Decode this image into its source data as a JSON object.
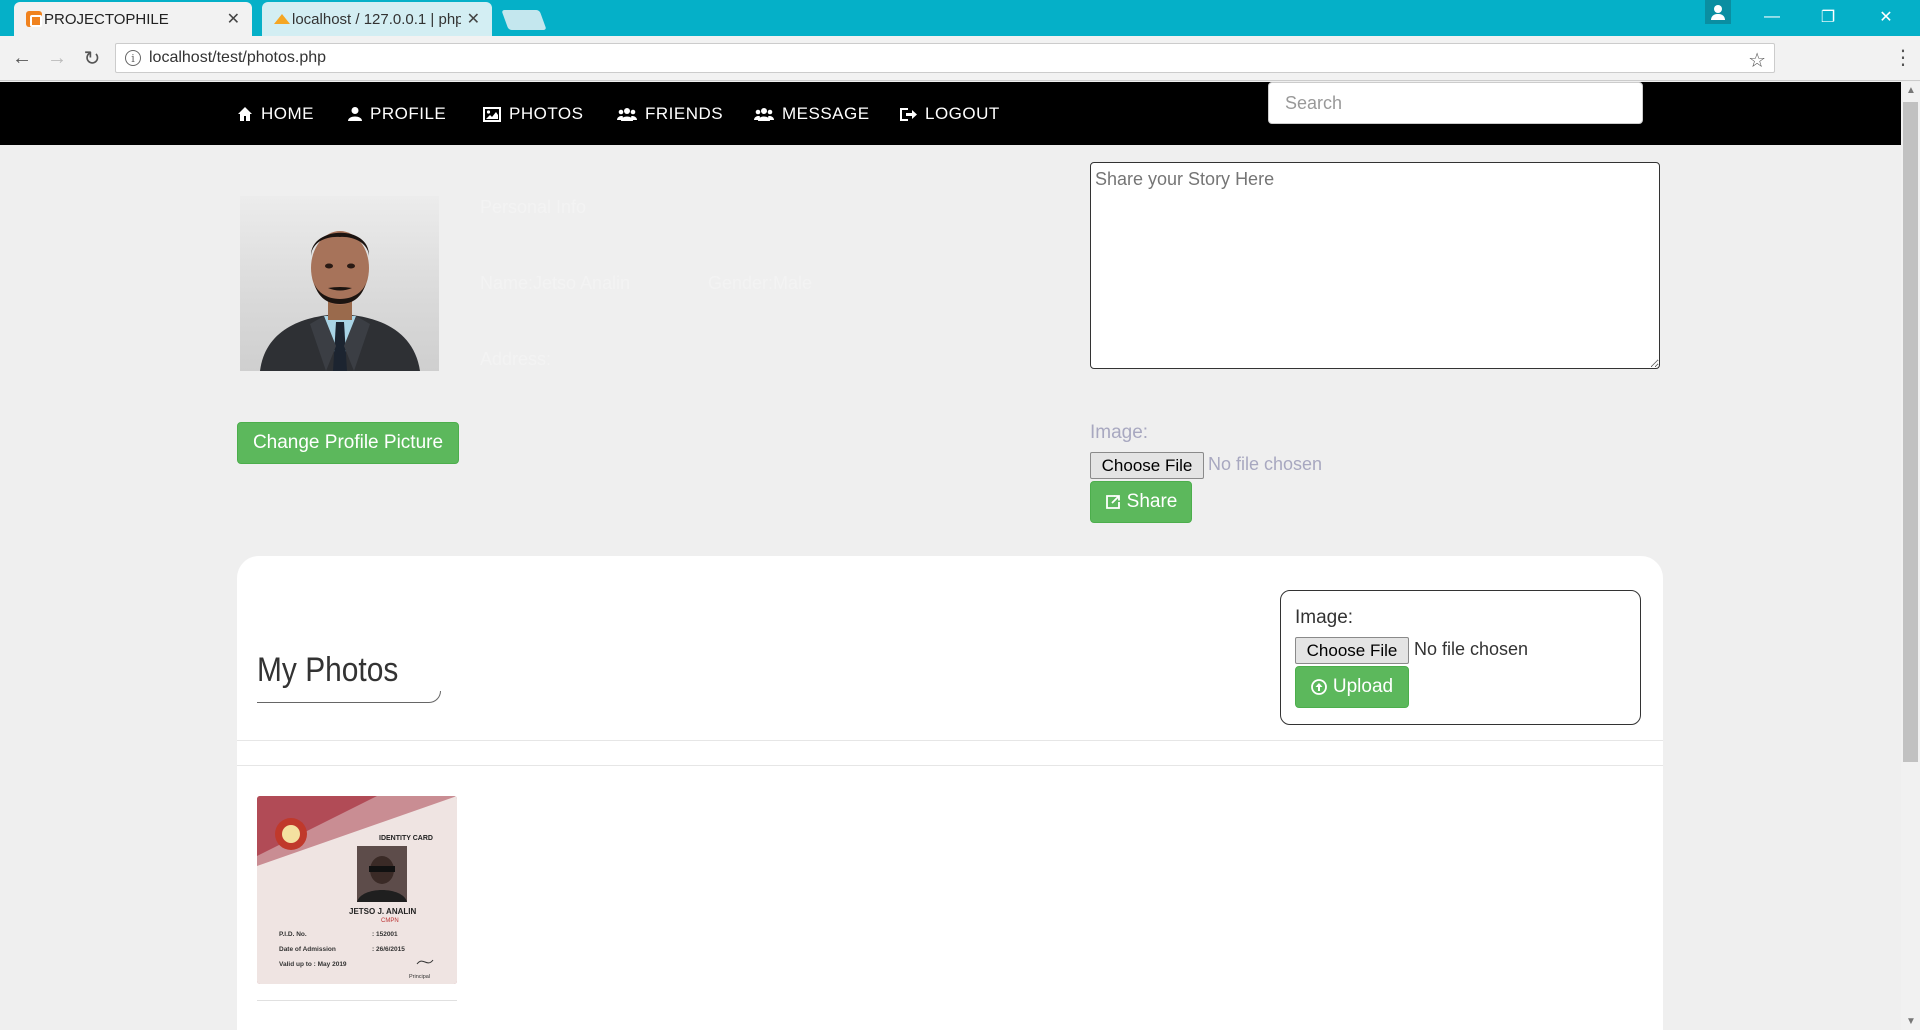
{
  "browser": {
    "tabs": [
      {
        "title": "PROJECTOPHILE",
        "active": true
      },
      {
        "title": "localhost / 127.0.0.1 | php",
        "active": false
      }
    ],
    "url": "localhost/test/photos.php"
  },
  "nav": {
    "items": [
      {
        "label": "HOME",
        "icon": "home-icon"
      },
      {
        "label": "PROFILE",
        "icon": "user-icon"
      },
      {
        "label": "PHOTOS",
        "icon": "picture-icon"
      },
      {
        "label": "FRIENDS",
        "icon": "users-icon"
      },
      {
        "label": "MESSAGE",
        "icon": "users-icon"
      },
      {
        "label": "LOGOUT",
        "icon": "sign-out-icon"
      }
    ],
    "search_placeholder": "Search"
  },
  "profile": {
    "heading": "Personal Info",
    "name": "Name:Jetso Analin",
    "gender": "Gender:Male",
    "address": "Address:",
    "change_picture_label": "Change Profile Picture"
  },
  "share": {
    "placeholder": "Share your Story Here",
    "image_label": "Image:",
    "choose_file_label": "Choose File",
    "no_file_text": "No file chosen",
    "share_label": "Share"
  },
  "photos": {
    "title": "My Photos",
    "image_label": "Image:",
    "choose_file_label": "Choose File",
    "no_file_text": "No file chosen",
    "upload_label": "Upload",
    "id_card": {
      "header": "IDENTITY CARD",
      "name": "JETSO J. ANALIN",
      "dept": "CMPN",
      "pid_label": "P.I.D. No.",
      "pid_value": ": 152001",
      "doa_label": "Date of Admission",
      "doa_value": ": 26/6/2015",
      "valid_label": "Valid up to : May 2019",
      "sign": "Principal"
    }
  },
  "colors": {
    "titlebar": "#05b0c8",
    "nav_bg": "#000000",
    "button_green": "#5cb85c",
    "page_bg": "#efefef"
  }
}
